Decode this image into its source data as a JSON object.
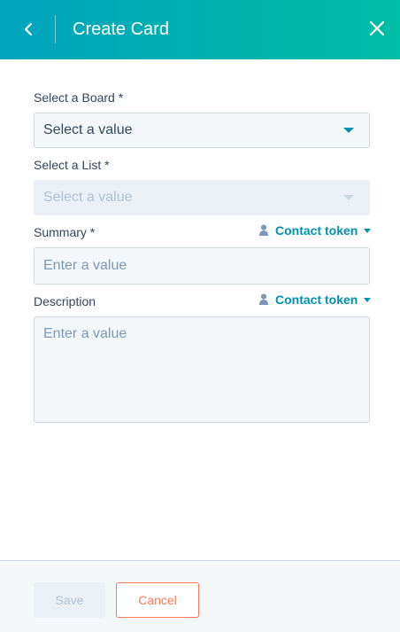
{
  "header": {
    "title": "Create Card",
    "back_icon": "chevron-left-icon",
    "close_icon": "close-icon"
  },
  "form": {
    "board": {
      "label": "Select a Board *",
      "value": "Select a value"
    },
    "list": {
      "label": "Select a List *",
      "value": "Select a value",
      "disabled": true
    },
    "summary": {
      "label": "Summary *",
      "placeholder": "Enter a value",
      "token_label": "Contact token"
    },
    "description": {
      "label": "Description",
      "placeholder": "Enter a value",
      "token_label": "Contact token"
    }
  },
  "footer": {
    "save_label": "Save",
    "cancel_label": "Cancel"
  },
  "colors": {
    "header_gradient_start": "#00a4bd",
    "header_gradient_end": "#00bda5",
    "link": "#0091ae",
    "cancel": "#ff7a59"
  }
}
